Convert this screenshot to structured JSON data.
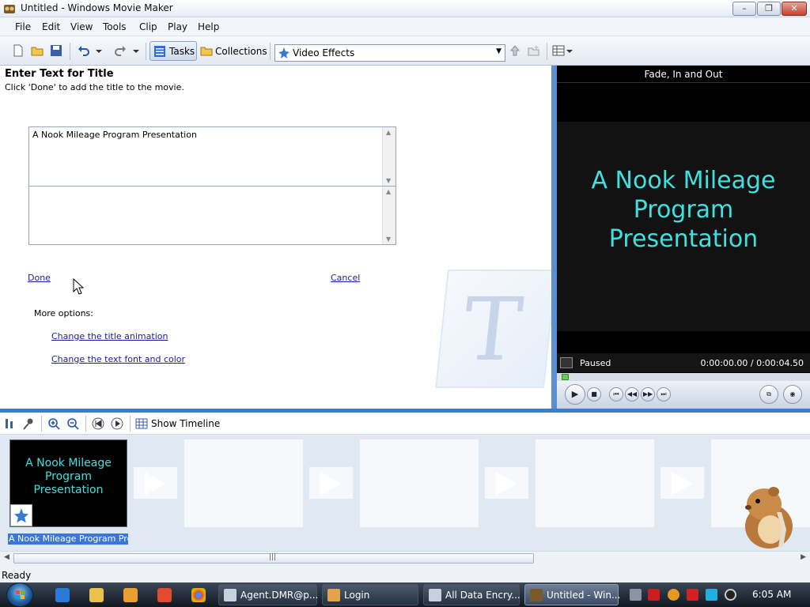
{
  "window": {
    "title": "Untitled - Windows Movie Maker",
    "minimize": "–",
    "maximize": "❐",
    "close": "✕"
  },
  "menu": [
    "File",
    "Edit",
    "View",
    "Tools",
    "Clip",
    "Play",
    "Help"
  ],
  "toolbar": {
    "tasks_label": "Tasks",
    "collections_label": "Collections",
    "effects_dropdown_value": "Video Effects"
  },
  "task_pane": {
    "heading": "Enter Text for Title",
    "instructions": "Click 'Done' to add the title to the movie.",
    "title_text": "A Nook Mileage Program Presentation",
    "second_text": "",
    "done_label": "Done",
    "cancel_label": "Cancel",
    "more_options_label": "More options:",
    "option_animation": "Change the title animation",
    "option_font": "Change the text font and color",
    "watermark_letter": "T"
  },
  "preview": {
    "effect_title": "Fade, In and Out",
    "display_text": "A Nook Mileage Program Presentation",
    "status": "Paused",
    "time": "0:00:00.00 / 0:00:04.50",
    "progress": 0
  },
  "storyboard": {
    "show_timeline_label": "Show Timeline",
    "clip_thumb_text": "A Nook Mileage Program Presentation",
    "clip_caption": "A Nook Mileage Program Pres..."
  },
  "statusbar": {
    "text": "Ready"
  },
  "taskbar": {
    "buttons": [
      {
        "label": "Agent.DMR@p..."
      },
      {
        "label": "Login"
      },
      {
        "label": "All Data Encry..."
      },
      {
        "label": "Untitled - Win..."
      }
    ],
    "clock": "6:05 AM"
  },
  "colors": {
    "accent_blue": "#3d7bd0",
    "title_text_cyan": "#40e0e0",
    "link_blue": "#1a1aa6",
    "selection_blue": "#3b78d4"
  }
}
